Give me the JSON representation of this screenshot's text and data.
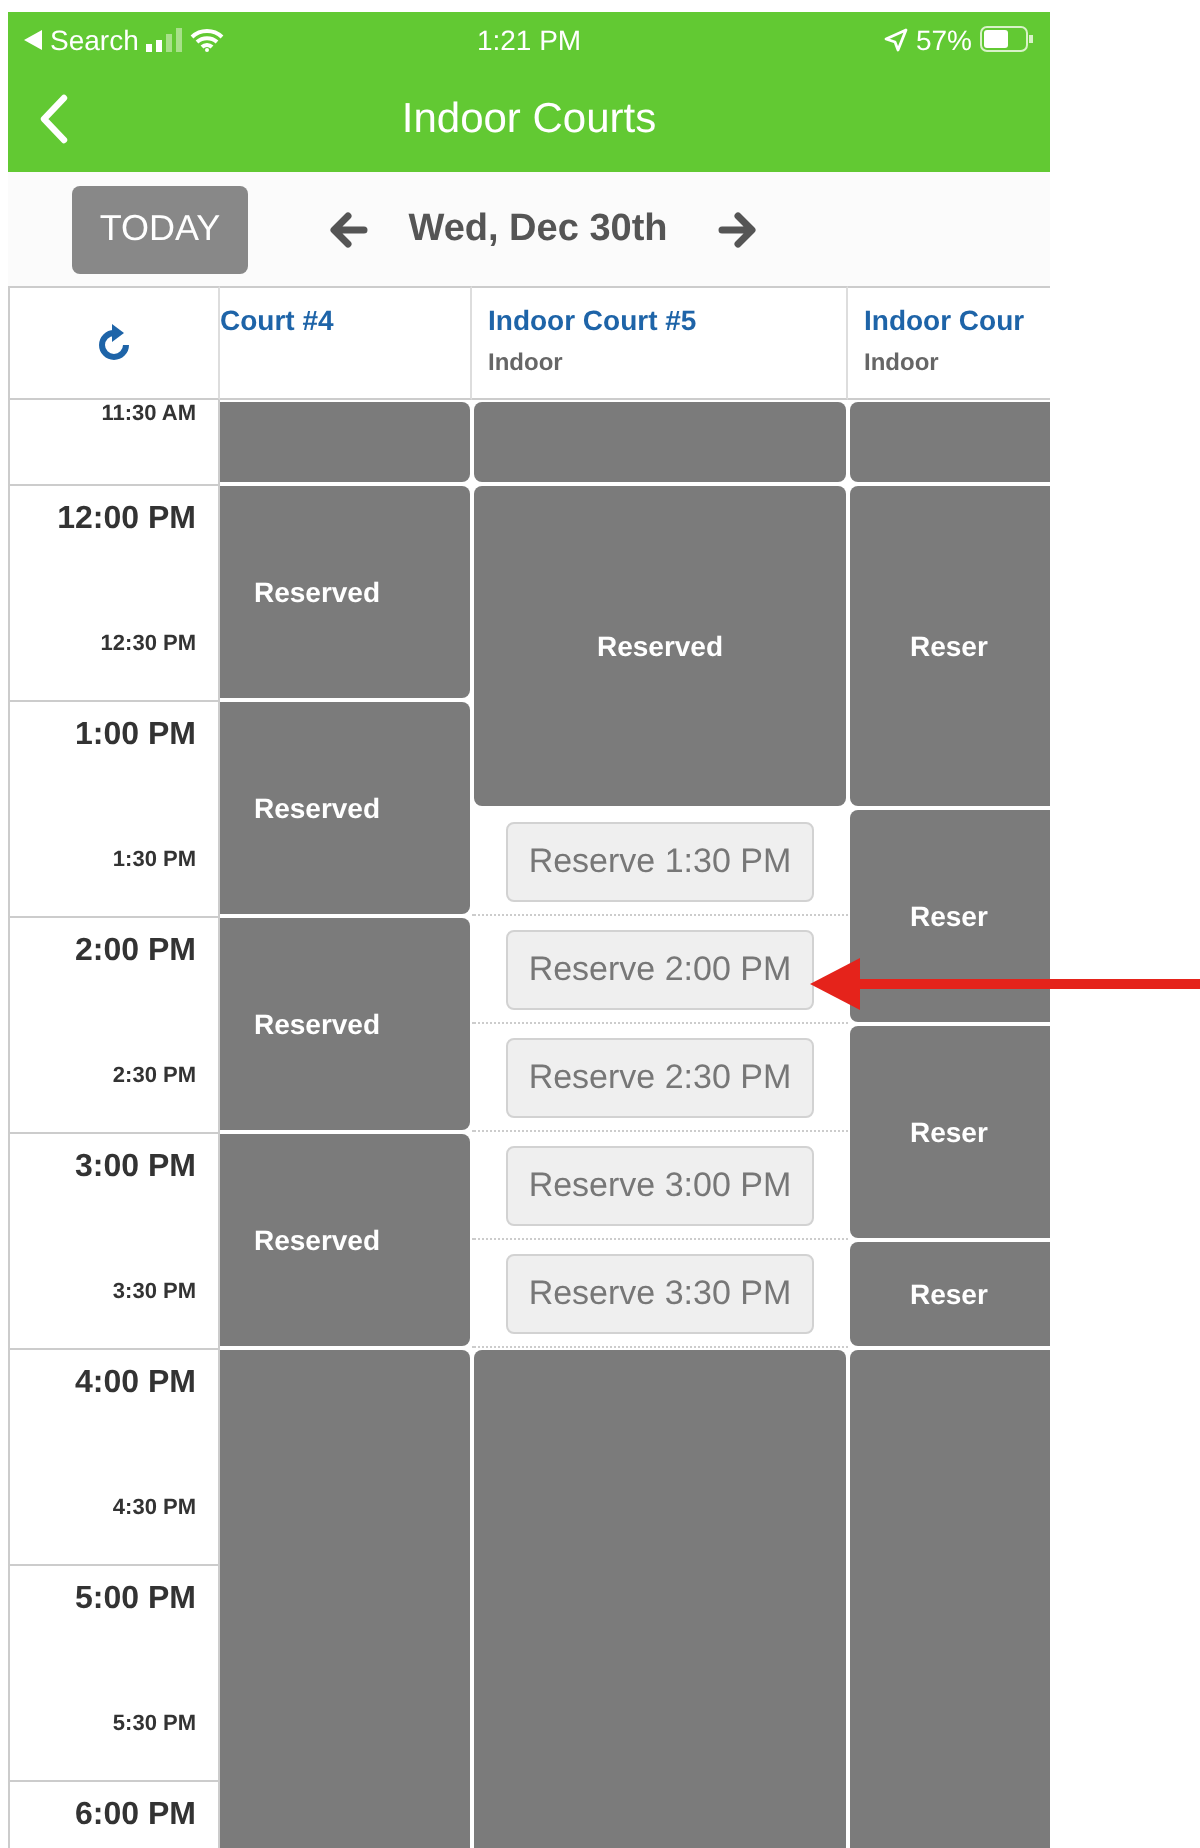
{
  "status_bar": {
    "back_label": "Search",
    "time": "1:21 PM",
    "battery": "57%"
  },
  "nav": {
    "title": "Indoor Courts"
  },
  "date_bar": {
    "today_button": "TODAY",
    "date": "Wed, Dec 30th"
  },
  "times": [
    {
      "label": "11:30 AM",
      "kind": "half"
    },
    {
      "label": "12:00 PM",
      "kind": "hour"
    },
    {
      "label": "12:30 PM",
      "kind": "half"
    },
    {
      "label": "1:00 PM",
      "kind": "hour"
    },
    {
      "label": "1:30 PM",
      "kind": "half"
    },
    {
      "label": "2:00 PM",
      "kind": "hour"
    },
    {
      "label": "2:30 PM",
      "kind": "half"
    },
    {
      "label": "3:00 PM",
      "kind": "hour"
    },
    {
      "label": "3:30 PM",
      "kind": "half"
    },
    {
      "label": "4:00 PM",
      "kind": "hour"
    },
    {
      "label": "4:30 PM",
      "kind": "half"
    },
    {
      "label": "5:00 PM",
      "kind": "hour"
    },
    {
      "label": "5:30 PM",
      "kind": "half"
    },
    {
      "label": "6:00 PM",
      "kind": "hour"
    }
  ],
  "courts": [
    {
      "name": "Court #4",
      "cells": [
        {
          "kind": "reserved"
        },
        {
          "kind": "reserved",
          "label": "Reserved"
        },
        {
          "kind": "continued"
        },
        {
          "kind": "reserved",
          "label": "Reserved"
        },
        {
          "kind": "continued"
        },
        {
          "kind": "reserved",
          "label": "Reserved"
        },
        {
          "kind": "continued"
        },
        {
          "kind": "reserved",
          "label": "Reserved"
        },
        {
          "kind": "continued"
        },
        {
          "kind": "reserved"
        },
        {
          "kind": "continued"
        },
        {
          "kind": "continued"
        },
        {
          "kind": "continued"
        },
        {
          "kind": "continued"
        }
      ]
    },
    {
      "name": "Indoor Court #5",
      "type": "Indoor",
      "cells": [
        {
          "kind": "reserved"
        },
        {
          "kind": "reserved",
          "label": "Reserved"
        },
        {
          "kind": "continued"
        },
        {
          "kind": "continued"
        },
        {
          "kind": "open",
          "label": "Reserve 1:30 PM"
        },
        {
          "kind": "open",
          "label": "Reserve 2:00 PM"
        },
        {
          "kind": "open",
          "label": "Reserve 2:30 PM"
        },
        {
          "kind": "open",
          "label": "Reserve 3:00 PM"
        },
        {
          "kind": "open",
          "label": "Reserve 3:30 PM"
        },
        {
          "kind": "reserved"
        },
        {
          "kind": "continued"
        },
        {
          "kind": "continued"
        },
        {
          "kind": "continued"
        },
        {
          "kind": "continued"
        }
      ]
    },
    {
      "name": "Indoor Cour",
      "type": "Indoor",
      "cells": [
        {
          "kind": "reserved"
        },
        {
          "kind": "reserved",
          "label": "Reser"
        },
        {
          "kind": "continued"
        },
        {
          "kind": "continued"
        },
        {
          "kind": "reserved",
          "label": "Reser"
        },
        {
          "kind": "continued"
        },
        {
          "kind": "reserved",
          "label": "Reser"
        },
        {
          "kind": "continued"
        },
        {
          "kind": "reserved",
          "label": "Reser"
        },
        {
          "kind": "reserved"
        },
        {
          "kind": "continued"
        },
        {
          "kind": "continued"
        },
        {
          "kind": "continued"
        },
        {
          "kind": "continued"
        }
      ]
    }
  ]
}
